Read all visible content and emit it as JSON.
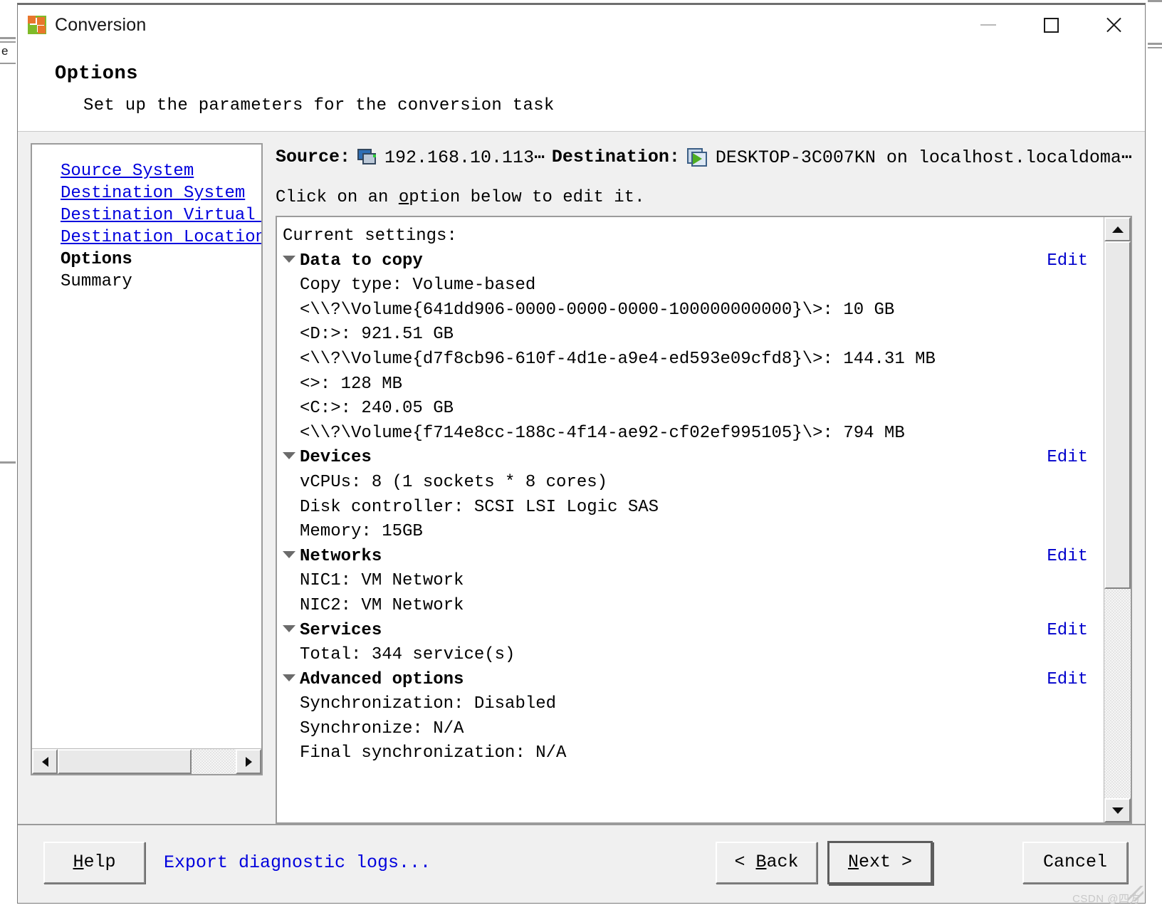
{
  "window": {
    "title": "Conversion",
    "icon": "conversion-app-icon",
    "controls": {
      "minimize": "minimize-icon",
      "maximize": "maximize-icon",
      "close": "close-icon"
    }
  },
  "background": {
    "edge_text": "e"
  },
  "header": {
    "title": "Options",
    "subtitle": "Set up the parameters for the conversion task"
  },
  "nav": {
    "items": [
      {
        "label": "Source System",
        "state": "link"
      },
      {
        "label": "Destination System",
        "state": "link"
      },
      {
        "label": "Destination Virtual M",
        "state": "link"
      },
      {
        "label": "Destination Location",
        "state": "link"
      },
      {
        "label": "Options",
        "state": "current"
      },
      {
        "label": "Summary",
        "state": "normal"
      }
    ]
  },
  "summary_line": {
    "source_label": "Source:",
    "source_value": "192.168.10.113⋯",
    "destination_label": "Destination:",
    "destination_value": "DESKTOP-3C007KN on localhost.localdoma⋯"
  },
  "hint": {
    "pre": "Click on an ",
    "underlined": "o",
    "post": "ption below to edit it."
  },
  "settings": {
    "heading": "Current settings:",
    "edit_label": "Edit",
    "groups": [
      {
        "name": "Data to copy",
        "edit": true,
        "rows": [
          "Copy type: Volume-based",
          "<\\\\?\\Volume{641dd906-0000-0000-0000-100000000000}\\>: 10 GB",
          "<D:>: 921.51 GB",
          "<\\\\?\\Volume{d7f8cb96-610f-4d1e-a9e4-ed593e09cfd8}\\>: 144.31 MB",
          "<>: 128 MB",
          "<C:>: 240.05 GB",
          "<\\\\?\\Volume{f714e8cc-188c-4f14-ae92-cf02ef995105}\\>: 794 MB"
        ]
      },
      {
        "name": "Devices",
        "edit": true,
        "rows": [
          "vCPUs: 8 (1 sockets * 8 cores)",
          "Disk controller: SCSI LSI Logic SAS",
          "Memory: 15GB"
        ]
      },
      {
        "name": "Networks",
        "edit": true,
        "rows": [
          "NIC1: VM Network",
          "NIC2: VM Network"
        ]
      },
      {
        "name": "Services",
        "edit": true,
        "rows": [
          "Total: 344 service(s)"
        ]
      },
      {
        "name": "Advanced options",
        "edit": true,
        "rows": [
          "Synchronization: Disabled",
          "Synchronize: N/A",
          "Final synchronization: N/A"
        ]
      }
    ]
  },
  "footer": {
    "help": {
      "mnemonic": "H",
      "rest": "elp"
    },
    "export_logs": "Export diagnostic logs...",
    "back": {
      "pre": "< ",
      "mnemonic": "B",
      "rest": "ack"
    },
    "next": {
      "mnemonic": "N",
      "rest": "ext >"
    },
    "cancel": "Cancel"
  },
  "watermark": "CSDN @四方",
  "colors": {
    "link": "#0000dd",
    "edit_link": "#0000cc",
    "dialog_bg": "#f0f0f0",
    "field_bg": "#ffffff",
    "accent_orange": "#e8762c",
    "accent_green": "#7fba28"
  }
}
